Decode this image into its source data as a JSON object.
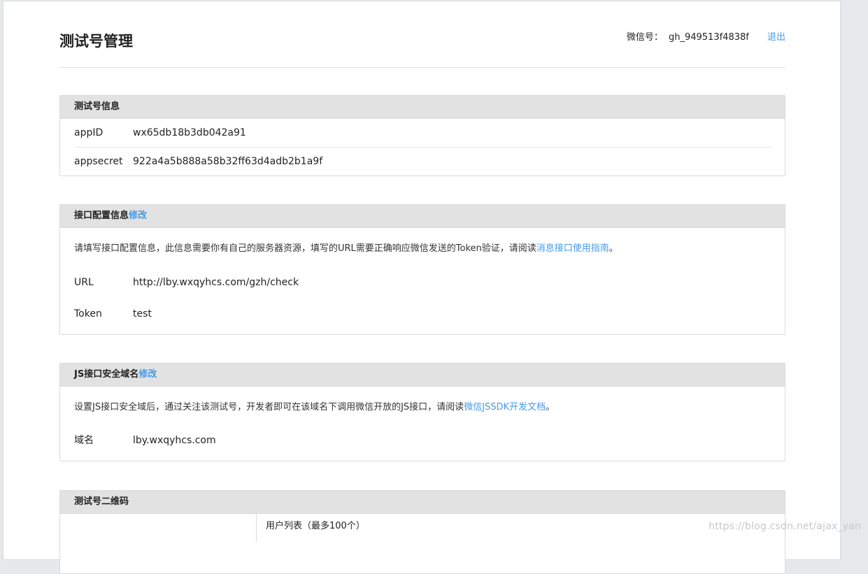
{
  "header": {
    "title": "测试号管理",
    "account_label": "微信号：",
    "account_id": "gh_949513f4838f",
    "logout": "退出"
  },
  "test_info": {
    "title": "测试号信息",
    "rows": [
      {
        "key": "appID",
        "value": "wx65db18b3db042a91"
      },
      {
        "key": "appsecret",
        "value": "922a4a5b888a58b32ff63d4adb2b1a9f"
      }
    ]
  },
  "api_config": {
    "title": "接口配置信息",
    "edit": "修改",
    "desc_prefix": "请填写接口配置信息，此信息需要你有自己的服务器资源，填写的URL需要正确响应微信发送的Token验证，请阅读",
    "desc_link": "消息接口使用指南",
    "desc_suffix": "。",
    "rows": [
      {
        "key": "URL",
        "value": "http://lby.wxqyhcs.com/gzh/check"
      },
      {
        "key": "Token",
        "value": "test"
      }
    ]
  },
  "js_domain": {
    "title": "JS接口安全域名",
    "edit": "修改",
    "desc_prefix": "设置JS接口安全域后，通过关注该测试号，开发者即可在该域名下调用微信开放的JS接口，请阅读",
    "desc_link": "微信JSSDK开发文档",
    "desc_suffix": "。",
    "rows": [
      {
        "key": "域名",
        "value": "lby.wxqyhcs.com"
      }
    ]
  },
  "qrcode": {
    "title": "测试号二维码",
    "user_list": "用户列表（最多100个）"
  },
  "watermark": "https://blog.csdn.net/ajax_yan"
}
